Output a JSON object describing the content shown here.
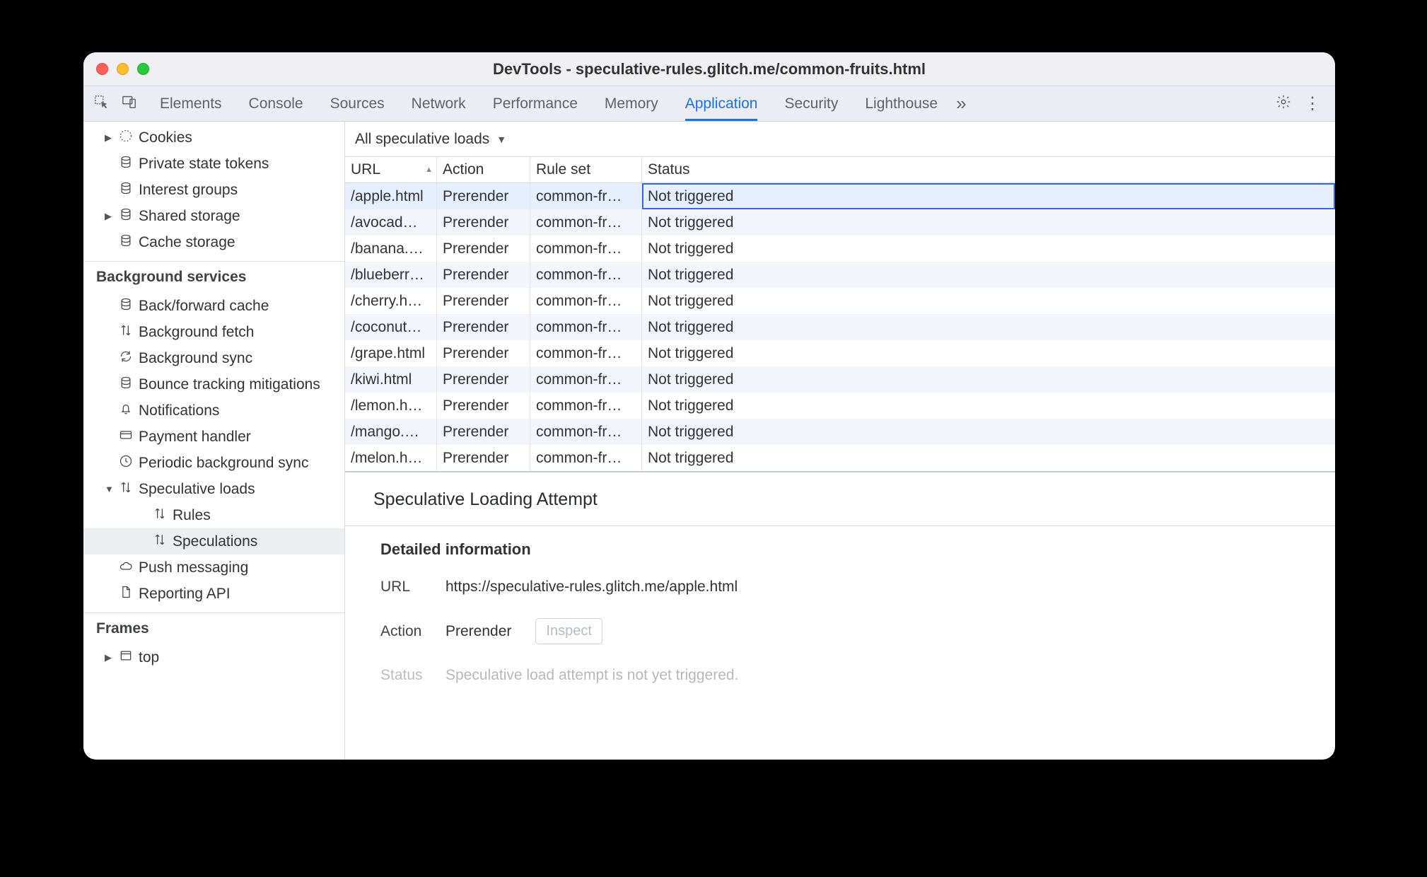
{
  "window": {
    "title": "DevTools - speculative-rules.glitch.me/common-fruits.html"
  },
  "tabs": {
    "items": [
      "Elements",
      "Console",
      "Sources",
      "Network",
      "Performance",
      "Memory",
      "Application",
      "Security",
      "Lighthouse"
    ],
    "active_index": 6
  },
  "sidebar": {
    "storage_items": [
      {
        "label": "Cookies",
        "icon": "cookie",
        "has_children": true
      },
      {
        "label": "Private state tokens",
        "icon": "db"
      },
      {
        "label": "Interest groups",
        "icon": "db"
      },
      {
        "label": "Shared storage",
        "icon": "db",
        "has_children": true
      },
      {
        "label": "Cache storage",
        "icon": "db"
      }
    ],
    "bg_heading": "Background services",
    "bg_items": [
      {
        "label": "Back/forward cache",
        "icon": "db"
      },
      {
        "label": "Background fetch",
        "icon": "arrows"
      },
      {
        "label": "Background sync",
        "icon": "sync"
      },
      {
        "label": "Bounce tracking mitigations",
        "icon": "db"
      },
      {
        "label": "Notifications",
        "icon": "bell"
      },
      {
        "label": "Payment handler",
        "icon": "card"
      },
      {
        "label": "Periodic background sync",
        "icon": "clock"
      },
      {
        "label": "Speculative loads",
        "icon": "arrows",
        "expanded": true,
        "children": [
          {
            "label": "Rules"
          },
          {
            "label": "Speculations",
            "selected": true
          }
        ]
      },
      {
        "label": "Push messaging",
        "icon": "cloud"
      },
      {
        "label": "Reporting API",
        "icon": "doc"
      }
    ],
    "frames_heading": "Frames",
    "frames_items": [
      {
        "label": "top",
        "icon": "frame",
        "has_children": true
      }
    ]
  },
  "filter": {
    "label": "All speculative loads"
  },
  "columns": {
    "url": "URL",
    "action": "Action",
    "rule": "Rule set",
    "status": "Status"
  },
  "rows": [
    {
      "url": "/apple.html",
      "action": "Prerender",
      "rule": "common-fr…",
      "status": "Not triggered",
      "selected": true
    },
    {
      "url": "/avocad…",
      "action": "Prerender",
      "rule": "common-fr…",
      "status": "Not triggered"
    },
    {
      "url": "/banana.…",
      "action": "Prerender",
      "rule": "common-fr…",
      "status": "Not triggered"
    },
    {
      "url": "/blueberr…",
      "action": "Prerender",
      "rule": "common-fr…",
      "status": "Not triggered"
    },
    {
      "url": "/cherry.h…",
      "action": "Prerender",
      "rule": "common-fr…",
      "status": "Not triggered"
    },
    {
      "url": "/coconut…",
      "action": "Prerender",
      "rule": "common-fr…",
      "status": "Not triggered"
    },
    {
      "url": "/grape.html",
      "action": "Prerender",
      "rule": "common-fr…",
      "status": "Not triggered"
    },
    {
      "url": "/kiwi.html",
      "action": "Prerender",
      "rule": "common-fr…",
      "status": "Not triggered"
    },
    {
      "url": "/lemon.h…",
      "action": "Prerender",
      "rule": "common-fr…",
      "status": "Not triggered"
    },
    {
      "url": "/mango.…",
      "action": "Prerender",
      "rule": "common-fr…",
      "status": "Not triggered"
    },
    {
      "url": "/melon.h…",
      "action": "Prerender",
      "rule": "common-fr…",
      "status": "Not triggered"
    }
  ],
  "detail": {
    "heading": "Speculative Loading Attempt",
    "subheading": "Detailed information",
    "url_label": "URL",
    "url_value": "https://speculative-rules.glitch.me/apple.html",
    "action_label": "Action",
    "action_value": "Prerender",
    "inspect_label": "Inspect",
    "status_label": "Status",
    "status_value": "Speculative load attempt is not yet triggered."
  }
}
